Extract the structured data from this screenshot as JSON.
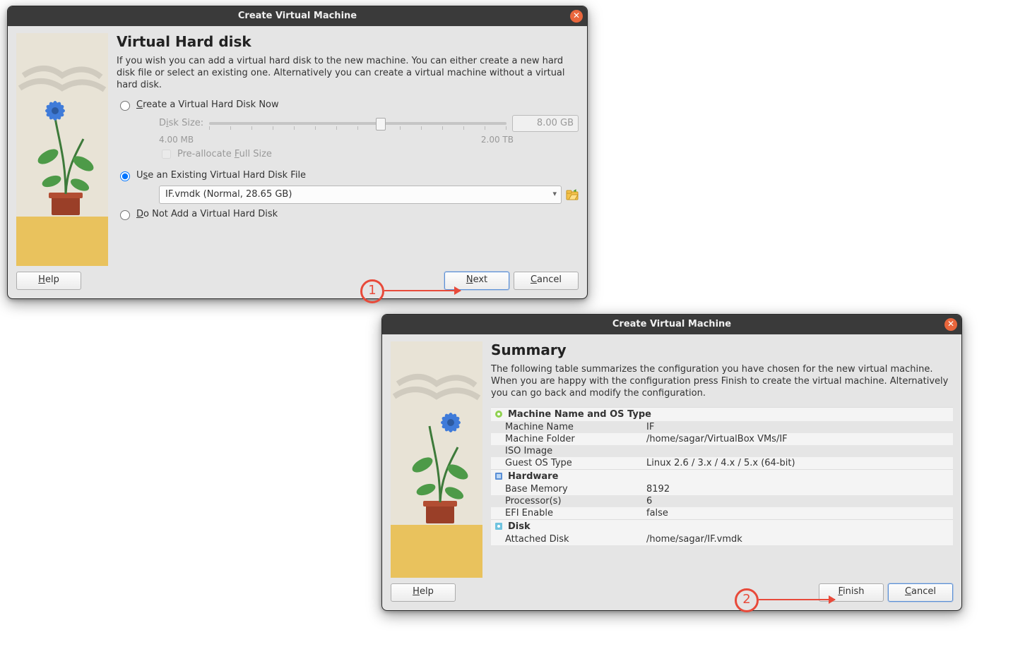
{
  "dialog1": {
    "title": "Create Virtual Machine",
    "heading": "Virtual Hard disk",
    "description": "If you wish you can add a virtual hard disk to the new machine. You can either create a new hard disk file or select an existing one. Alternatively you can create a virtual machine without a virtual hard disk.",
    "radio_create": "Create a Virtual Hard Disk Now",
    "disk_size_label": "Disk Size:",
    "disk_size_value": "8.00 GB",
    "range_min": "4.00 MB",
    "range_max": "2.00 TB",
    "prealloc_label": "Pre-allocate Full Size",
    "radio_existing": "Use an Existing Virtual Hard Disk File",
    "existing_selected": "IF.vmdk (Normal, 28.65 GB)",
    "radio_none": "Do Not Add a Virtual Hard Disk",
    "help": "Help",
    "next": "Next",
    "cancel": "Cancel",
    "step": "1"
  },
  "dialog2": {
    "title": "Create Virtual Machine",
    "heading": "Summary",
    "description": "The following table summarizes the configuration you have chosen for the new virtual machine. When you are happy with the configuration press Finish to create the virtual machine. Alternatively you can go back and modify the configuration.",
    "sections": {
      "machine": {
        "header": "Machine Name and OS Type",
        "rows": [
          {
            "k": "Machine Name",
            "v": "IF"
          },
          {
            "k": "Machine Folder",
            "v": "/home/sagar/VirtualBox VMs/IF"
          },
          {
            "k": "ISO Image",
            "v": ""
          },
          {
            "k": "Guest OS Type",
            "v": "Linux 2.6 / 3.x / 4.x / 5.x (64-bit)"
          }
        ]
      },
      "hardware": {
        "header": "Hardware",
        "rows": [
          {
            "k": "Base Memory",
            "v": "8192"
          },
          {
            "k": "Processor(s)",
            "v": "6"
          },
          {
            "k": "EFI Enable",
            "v": "false"
          }
        ]
      },
      "disk": {
        "header": "Disk",
        "rows": [
          {
            "k": "Attached Disk",
            "v": "/home/sagar/IF.vmdk"
          }
        ]
      }
    },
    "help": "Help",
    "finish": "Finish",
    "cancel": "Cancel",
    "step": "2"
  }
}
